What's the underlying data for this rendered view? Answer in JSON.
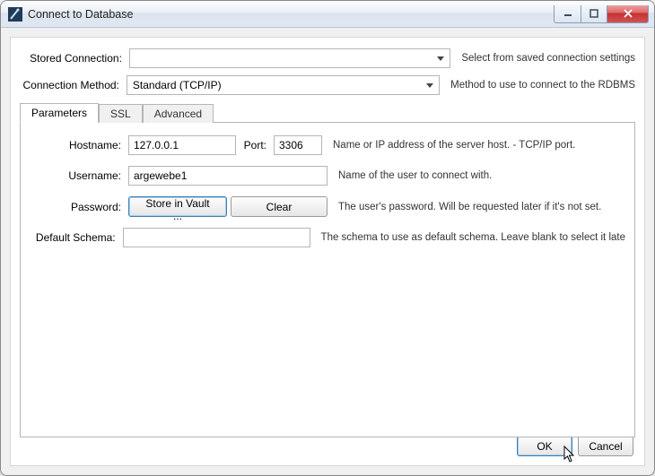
{
  "window": {
    "title": "Connect to Database"
  },
  "top_form": {
    "stored_connection": {
      "label": "Stored Connection:",
      "value": "",
      "desc": "Select from saved connection settings"
    },
    "connection_method": {
      "label": "Connection Method:",
      "value": "Standard (TCP/IP)",
      "desc": "Method to use to connect to the RDBMS"
    }
  },
  "tabs": {
    "items": [
      "Parameters",
      "SSL",
      "Advanced"
    ],
    "active_index": 0
  },
  "params": {
    "hostname": {
      "label": "Hostname:",
      "value": "127.0.0.1"
    },
    "port": {
      "label": "Port:",
      "value": "3306"
    },
    "host_help": "Name or IP address of the server host. - TCP/IP port.",
    "username": {
      "label": "Username:",
      "value": "argewebe1",
      "help": "Name of the user to connect with."
    },
    "password": {
      "label": "Password:",
      "store_btn": "Store in Vault ...",
      "clear_btn": "Clear",
      "help": "The user's password. Will be requested later if it's not set."
    },
    "default_schema": {
      "label": "Default Schema:",
      "value": "",
      "help": "The schema to use as default schema. Leave blank to select it late"
    }
  },
  "footer": {
    "ok": "OK",
    "cancel": "Cancel"
  }
}
